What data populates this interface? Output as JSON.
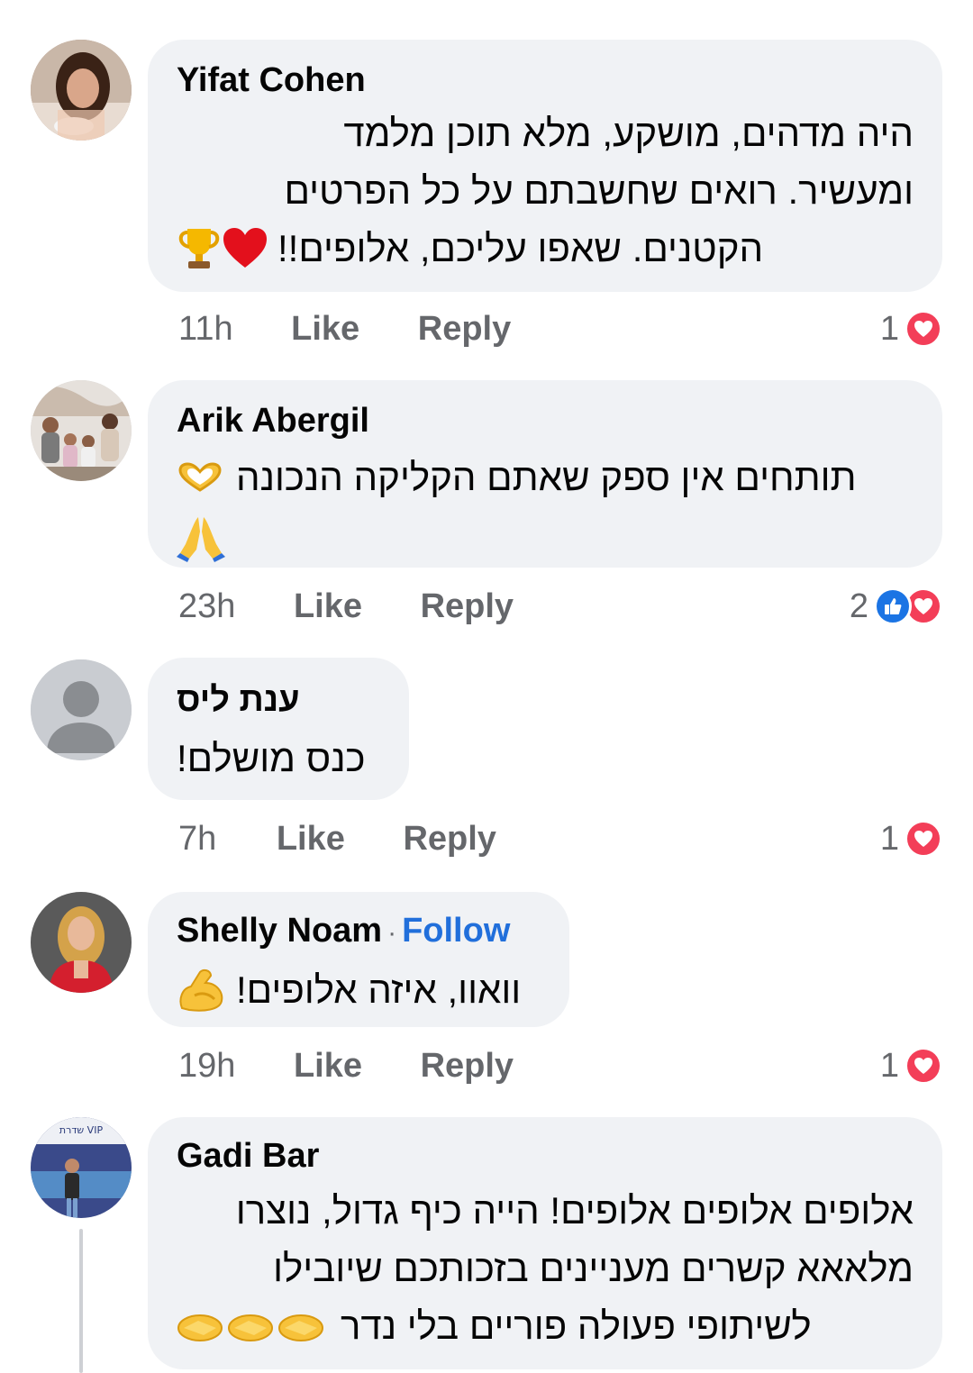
{
  "colors": {
    "bubble": "#f0f2f5",
    "meta": "#65676b",
    "follow": "#216fdb",
    "love": "#f33e58",
    "like": "#1b74e4"
  },
  "comments": [
    {
      "name": "Yifat Cohen",
      "lines": [
        "היה מדהים, מושקע, מלא תוכן מלמד",
        "ומעשיר. רואים שחשבתם על כל הפרטים",
        "הקטנים. שאפו עליכם, אלופים!!"
      ],
      "line_emojis": [
        "",
        "",
        "heart-emoji trophy-emoji"
      ],
      "time": "11h",
      "like": "Like",
      "reply": "Reply",
      "reaction_count": "1",
      "reactions": [
        "love"
      ]
    },
    {
      "name": "Arik Abergil",
      "lines": [
        "תותחים אין ספק שאתם הקליקה הנכונה"
      ],
      "line_emojis": [
        "heart-hands-emoji",
        "folded-hands-emoji"
      ],
      "time": "23h",
      "like": "Like",
      "reply": "Reply",
      "reaction_count": "2",
      "reactions": [
        "like",
        "love"
      ]
    },
    {
      "name": "ענת ליס",
      "lines": [
        "כנס מושלם!"
      ],
      "time": "7h",
      "like": "Like",
      "reply": "Reply",
      "reaction_count": "1",
      "reactions": [
        "love"
      ]
    },
    {
      "name": "Shelly Noam",
      "follow": "Follow",
      "lines": [
        "וואוו, איזה אלופים!"
      ],
      "line_emojis": [
        "flexed-biceps-emoji"
      ],
      "time": "19h",
      "like": "Like",
      "reply": "Reply",
      "reaction_count": "1",
      "reactions": [
        "love"
      ]
    },
    {
      "name": "Gadi Bar",
      "lines": [
        "אלופים אלופים אלופים! הייה כיף גדול, נוצרו",
        "מלאאא קשרים מעניינים בזכותכם שיובילו",
        "לשיתופי פעולה פוריים בלי נדר"
      ],
      "line_emojis": [
        "",
        "",
        "handshake-emoji x3"
      ]
    }
  ],
  "avatar_sign_text": "שדרת VIP"
}
